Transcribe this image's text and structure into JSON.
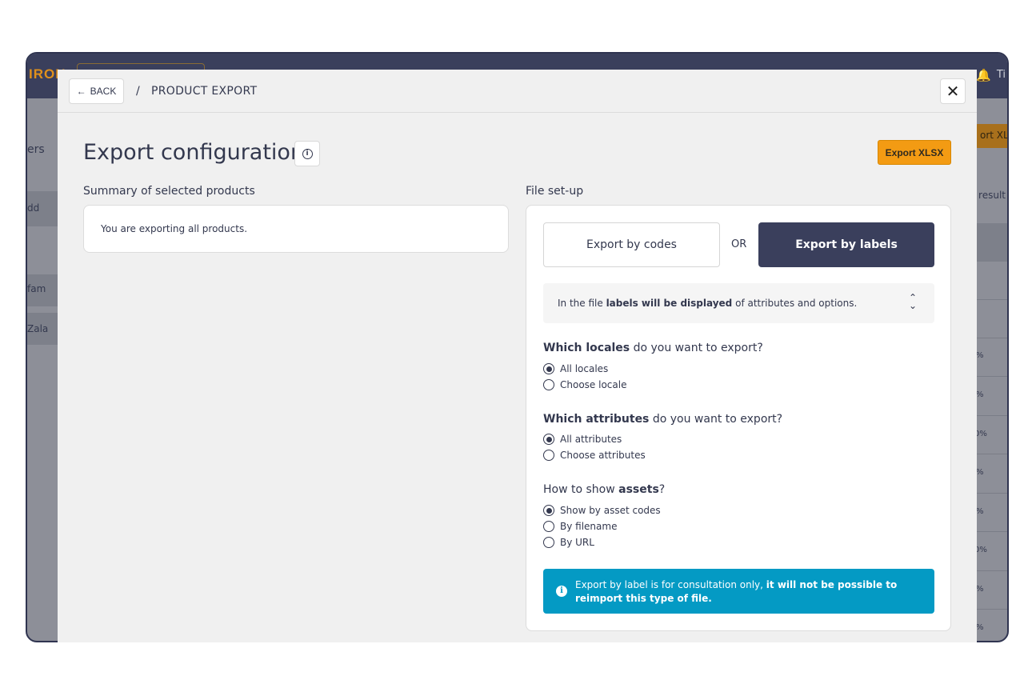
{
  "background_app": {
    "logo": "IRON",
    "sidebar_fragments": [
      "ers",
      "dd",
      "fam",
      "Zala"
    ],
    "right_fragments": [
      "ort XLS",
      "result",
      "%",
      "%",
      "0%",
      "%",
      "%",
      "0%",
      "%",
      "%"
    ],
    "user_initials": "Ti"
  },
  "modal": {
    "back_label": "BACK",
    "breadcrumb_sep": "/",
    "breadcrumb_title": "PRODUCT EXPORT",
    "page_title": "Export configuration",
    "export_button": "Export XLSX",
    "summary": {
      "label": "Summary of selected products",
      "text": "You are exporting all products."
    },
    "file_setup": {
      "label": "File set-up",
      "export_by_codes": "Export by codes",
      "or_label": "OR",
      "export_by_labels": "Export by labels",
      "info_prefix": "In the file ",
      "info_bold": "labels will be displayed",
      "info_suffix": " of attributes and options.",
      "locales_q_bold": "Which locales",
      "locales_q_rest": " do you want to export?",
      "locales_options": [
        "All locales",
        "Choose locale"
      ],
      "attributes_q_bold": "Which attributes",
      "attributes_q_rest": " do you want to export?",
      "attributes_options": [
        "All attributes",
        "Choose attributes"
      ],
      "assets_q_prefix": "How to show ",
      "assets_q_bold": "assets",
      "assets_q_suffix": "?",
      "assets_options": [
        "Show by asset codes",
        "By filename",
        "By URL"
      ],
      "notice_text": "Export by label is for consultation only, ",
      "notice_bold": "it will not be possible to reimport this type of file."
    }
  },
  "colors": {
    "primary_dark": "#3a3f5c",
    "accent_orange": "#f39b13",
    "notice_blue": "#049ac4"
  }
}
